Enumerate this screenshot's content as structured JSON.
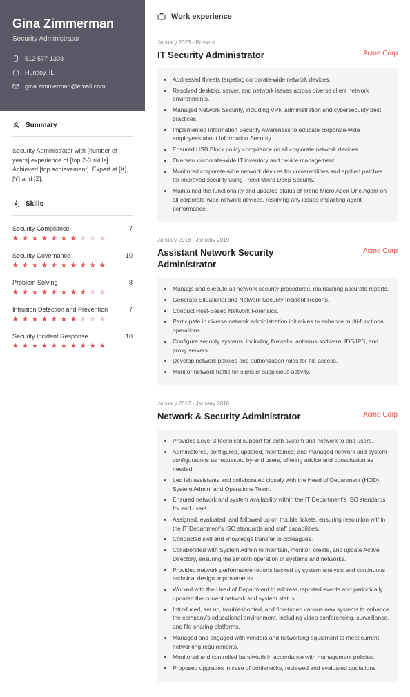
{
  "name": "Gina Zimmerman",
  "title": "Security Administrator",
  "contact": {
    "phone": "512-577-1303",
    "location": "Huntley, IL",
    "email": "gina.zimmerman@email.com"
  },
  "sections": {
    "summary_label": "Summary",
    "skills_label": "Skills",
    "work_label": "Work experience"
  },
  "summary": "Security Administrator with [number of years] experience of [top 2-3 skills]. Achieved [top achievement]. Expert at [X], [Y] and [Z].",
  "skills": [
    {
      "name": "Security Compliance",
      "rating": 7
    },
    {
      "name": "Security Governance",
      "rating": 10
    },
    {
      "name": "Problem Solving",
      "rating": 8
    },
    {
      "name": "Intrusion Detection and Prevention",
      "rating": 7
    },
    {
      "name": "Security Incident Response",
      "rating": 10
    }
  ],
  "jobs": [
    {
      "dates": "January 2023 - Present",
      "title": "IT Security Administrator",
      "company": "Acme Corp",
      "bullets": [
        "Addressed threats targeting corporate-wide network devices.",
        "Resolved desktop, server, and network issues across diverse client network environments.",
        "Managed Network Security, including VPN administration and cybersecurity best practices.",
        "Implemented Information Security Awareness to educate corporate-wide employees about Information Security.",
        "Ensured USB Block policy compliance on all corporate network devices.",
        "Oversaw corporate-wide IT inventory and device management.",
        "Monitored corporate-wide network devices for vulnerabilities and applied patches for improved security using Trend Micro Deep Security.",
        "Maintained the functionality and updated status of Trend Micro Apex One Agent on all corporate-wide network devices, resolving any issues impacting agent performance."
      ]
    },
    {
      "dates": "January 2018 - January 2019",
      "title": "Assistant Network Security Administrator",
      "company": "Acme Corp",
      "bullets": [
        "Manage and execute all network security procedures, maintaining accurate reports.",
        "Generate Situational and Network Security Incident Reports.",
        "Conduct Host-Based Network Forensics.",
        "Participate in diverse network administration initiatives to enhance multi-functional operations.",
        "Configure security systems, including firewalls, antivirus software, IDS/IPS, and proxy servers.",
        "Develop network policies and authorization roles for file access.",
        "Monitor network traffic for signs of suspicious activity."
      ]
    },
    {
      "dates": "January 2017 - January 2018",
      "title": "Network & Security Administrator",
      "company": "Acme Corp",
      "bullets": [
        "Provided Level 3 technical support for both system and network to end users.",
        "Administered, configured, updated, maintained, and managed network and system configurations as requested by end users, offering advice and consultation as needed.",
        "Led lab assistants and collaborated closely with the Head of Department (HOD), System Admin, and Operations Team.",
        "Ensured network and system availability within the IT Department's ISO standards for end users.",
        "Assigned, evaluated, and followed up on trouble tickets, ensuring resolution within the IT Department's ISO standards and staff capabilities.",
        "Conducted skill and knowledge transfer to colleagues.",
        "Collaborated with System Admin to maintain, monitor, create, and update Active Directory, ensuring the smooth operation of systems and networks.",
        "Provided network performance reports backed by system analysis and continuous technical design improvements.",
        "Worked with the Head of Department to address reported events and periodically updated the current network and system status.",
        "Introduced, set up, troubleshooted, and fine-tuned various new systems to enhance the company's educational environment, including video conferencing, surveillance, and file-sharing platforms.",
        "Managed and engaged with vendors and networking equipment to meet current networking requirements.",
        "Monitored and controlled bandwidth in accordance with management policies.",
        "Proposed upgrades in case of bottlenecks, reviewed and evaluated quotations"
      ]
    }
  ]
}
